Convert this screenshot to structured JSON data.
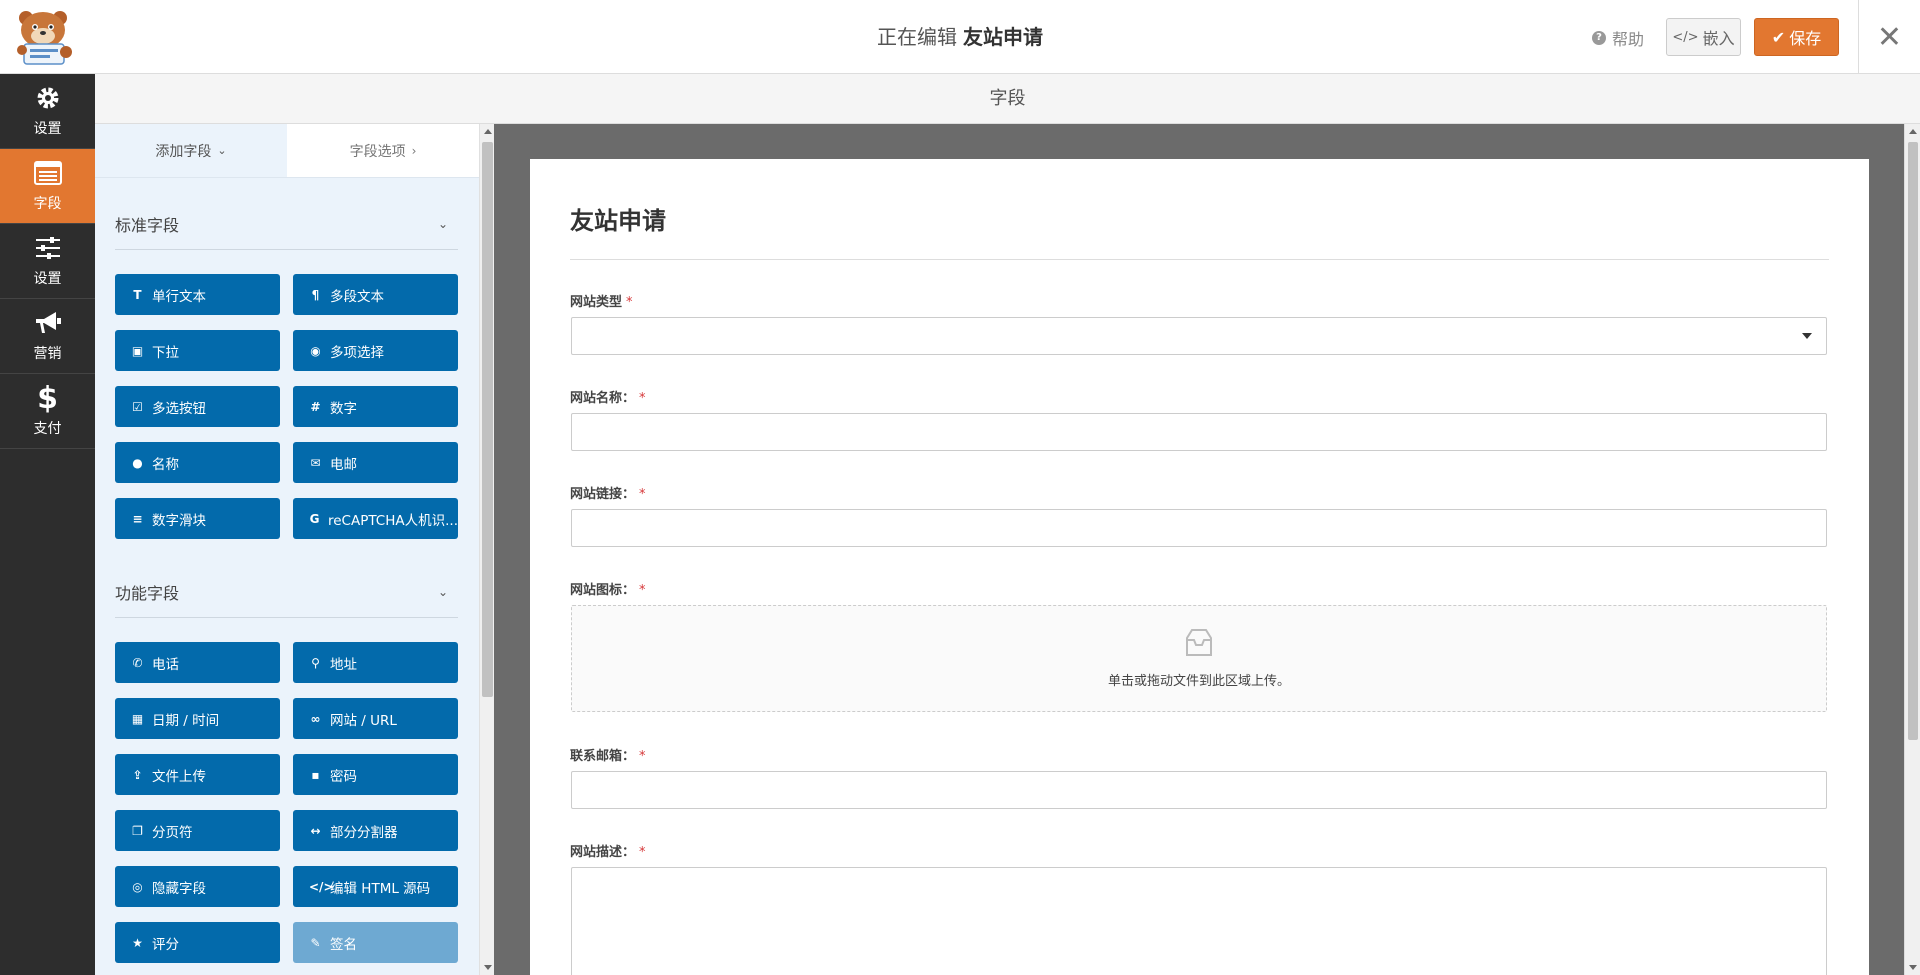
{
  "header": {
    "editing_prefix": "正在编辑",
    "form_name": "友站申请",
    "help_label": "帮助",
    "embed_label": "嵌入",
    "save_label": "保存"
  },
  "leftnav": {
    "items": [
      {
        "label": "设置",
        "icon": "gear-icon",
        "active": false
      },
      {
        "label": "字段",
        "icon": "fields-list-icon",
        "active": true
      },
      {
        "label": "设置",
        "icon": "sliders-icon",
        "active": false
      },
      {
        "label": "营销",
        "icon": "megaphone-icon",
        "active": false
      },
      {
        "label": "支付",
        "icon": "dollar-icon",
        "active": false
      }
    ]
  },
  "section_title": "字段",
  "panel": {
    "tabs": {
      "add_fields": "添加字段",
      "field_options": "字段选项"
    },
    "standard_group": {
      "title": "标准字段",
      "buttons": [
        {
          "label": "单行文本",
          "icon": "text-cursor-icon"
        },
        {
          "label": "多段文本",
          "icon": "paragraph-icon"
        },
        {
          "label": "下拉",
          "icon": "dropdown-icon"
        },
        {
          "label": "多项选择",
          "icon": "radio-dot-icon"
        },
        {
          "label": "多选按钮",
          "icon": "checkbox-icon"
        },
        {
          "label": "数字",
          "icon": "hash-icon"
        },
        {
          "label": "名称",
          "icon": "user-icon"
        },
        {
          "label": "电邮",
          "icon": "envelope-icon"
        },
        {
          "label": "数字滑块",
          "icon": "sliders-icon"
        },
        {
          "label": "reCAPTCHA人机识...",
          "icon": "google-icon"
        }
      ]
    },
    "fancy_group": {
      "title": "功能字段",
      "buttons": [
        {
          "label": "电话",
          "icon": "phone-icon"
        },
        {
          "label": "地址",
          "icon": "map-pin-icon"
        },
        {
          "label": "日期 / 时间",
          "icon": "calendar-icon"
        },
        {
          "label": "网站 / URL",
          "icon": "link-icon"
        },
        {
          "label": "文件上传",
          "icon": "upload-icon"
        },
        {
          "label": "密码",
          "icon": "lock-icon"
        },
        {
          "label": "分页符",
          "icon": "copy-icon"
        },
        {
          "label": "部分分割器",
          "icon": "arrows-h-icon"
        },
        {
          "label": "隐藏字段",
          "icon": "eye-slash-icon"
        },
        {
          "label": "编辑 HTML 源码",
          "icon": "code-icon"
        },
        {
          "label": "评分",
          "icon": "star-icon"
        },
        {
          "label": "签名",
          "icon": "pencil-icon",
          "disabled": true
        }
      ]
    }
  },
  "form": {
    "title": "友站申请",
    "fields": [
      {
        "label": "网站类型",
        "required_mark": "*",
        "type": "select"
      },
      {
        "label": "网站名称：",
        "required_mark": "*",
        "type": "text"
      },
      {
        "label": "网站链接：",
        "required_mark": "*",
        "type": "text"
      },
      {
        "label": "网站图标：",
        "required_mark": "*",
        "type": "upload"
      },
      {
        "label": "联系邮箱：",
        "required_mark": "*",
        "type": "text"
      },
      {
        "label": "网站描述：",
        "required_mark": "*",
        "type": "textarea"
      }
    ],
    "upload_hint": "单击或拖动文件到此区域上传。"
  },
  "colors": {
    "accent": "#e27730",
    "button_blue": "#036aab",
    "nav_dark": "#2d2d2d",
    "panel_bg": "#ebf3fb"
  }
}
